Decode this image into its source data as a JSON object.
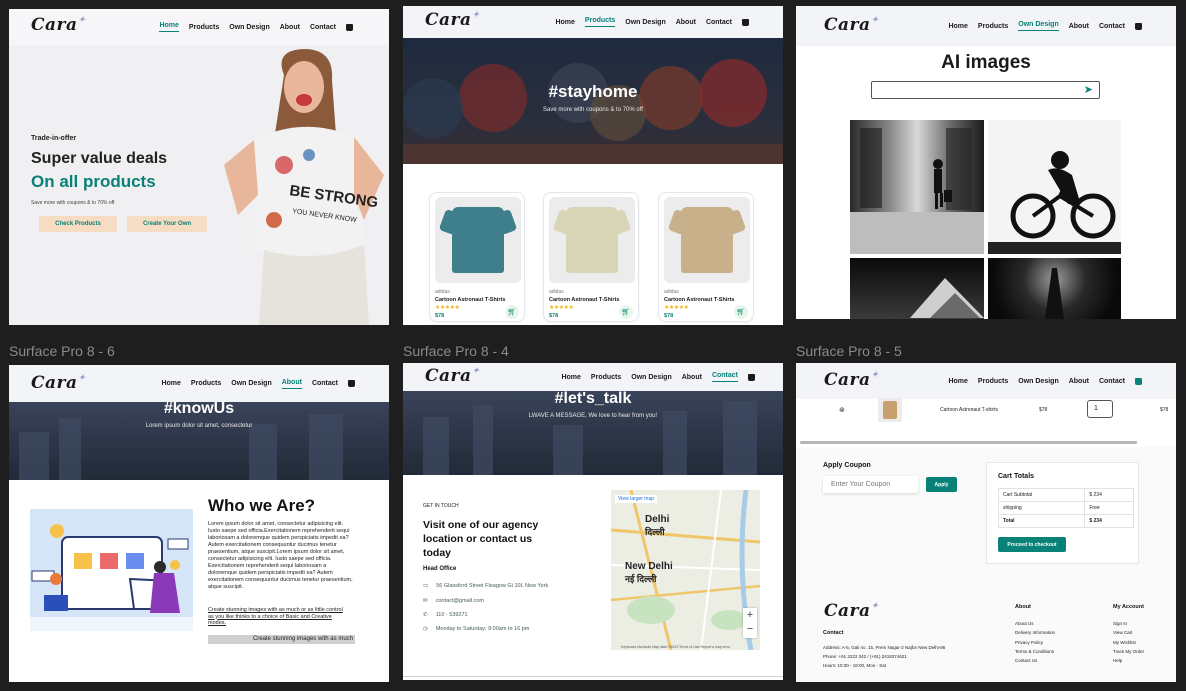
{
  "labels": {
    "f6": "Surface Pro 8 - 6",
    "f4": "Surface Pro 8 - 4",
    "f5": "Surface Pro 8 - 5"
  },
  "nav": {
    "logo": "Cara",
    "home": "Home",
    "products": "Products",
    "own_design": "Own Design",
    "about": "About",
    "contact": "Contact"
  },
  "home": {
    "kicker": "Trade-in-offer",
    "headline": "Super value deals",
    "headline2": "On all products",
    "sub": "Save more with coupons & to 70% off",
    "btn1": "Check Products",
    "btn2": "Create Your Own",
    "shirt_text1": "BE STRONG",
    "shirt_text2": "YOU NEVER KNOW"
  },
  "products": {
    "banner_title": "#stayhome",
    "banner_sub": "Save more with coupons & to 70% off",
    "items": [
      {
        "brand": "adidas",
        "name": "Cartoon Astronaut T-Shirts",
        "stars": "★★★★★",
        "price": "$78",
        "color": "#3f7f8c"
      },
      {
        "brand": "adidas",
        "name": "Cartoon Astronaut T-Shirts",
        "stars": "★★★★★",
        "price": "$78",
        "color": "#d9d6b8"
      },
      {
        "brand": "adidas",
        "name": "Cartoon Astronaut T-Shirts",
        "stars": "★★★★★",
        "price": "$78",
        "color": "#c8b08a"
      }
    ]
  },
  "design": {
    "title": "AI images"
  },
  "about": {
    "banner_title": "#knowUs",
    "banner_sub": "Lorem ipsum dolor sit amet, consectetur",
    "heading": "Who we Are?",
    "body": "Lorem ipsum dolor sit amet, consectetur adipisicing elit. Iusto saepe sed officia.Exercitationem reprehenderit sequi laboriosam a doloremque quidem perspiciatis impedit ea? Autem exercitationem consequuntur ducimus tenetur praesentium, atque suscipit.Lorem ipsum dolor sit amet, consectetur adipisicing elit. Iusto saepe sed officia. Exercitationem reprehenderit sequi laboriosam a doloremque quidem perspiciatis impedit ea? Autem exercitationem consequuntur ducimus tenetur praesentium, atque suscipit.",
    "link": "Create stunning images with as much or as little control as you like thinks to a choice of Basic and Creative modes.",
    "marquee": "Create stunning images with as much"
  },
  "contact": {
    "banner_title": "#let's_talk",
    "banner_sub": "LWAVE A MESSAGE, We love to hear from you!",
    "get_in_touch": "GET IN TOUCH",
    "heading": "Visit one of our agency location or contact us today",
    "head_office": "Head Office",
    "address": "56 Glassford Street Fleagow Gi 10L New York",
    "email": "contact@gmail.com",
    "phone": "110 - 539271",
    "hours": "Monday to Saturday: 9:00am to 16 pm",
    "map_link": "View larger map",
    "map_city1": "Delhi",
    "map_city1_hi": "दिल्ली",
    "map_city2": "New Delhi",
    "map_city2_hi": "नई दिल्ली",
    "map_footer": "Keyboard shortcuts   Map data ©2023   Terms of Use   Report a map error"
  },
  "cart": {
    "row_name": "Cartoon Astronaut T-shirts",
    "row_price": "$78",
    "row_qty": "1",
    "row_subtotal": "$78",
    "coupon_title": "Apply Coupon",
    "coupon_placeholder": "Enter Your Coupon",
    "apply": "Apply",
    "totals_title": "Cart Totals",
    "totals": [
      {
        "k": "Cart Subtotal",
        "v": "$ 234"
      },
      {
        "k": "shipping",
        "v": "Free"
      },
      {
        "k": "Total",
        "v": "$ 234"
      }
    ],
    "checkout": "Proceed to checkout",
    "footer_logo": "Cara",
    "contact_h": "Contact",
    "address": "Address: A-5, Gali no. 15, Prem Nagar-2 Najfor New Delhi-86",
    "phone": "Phone: +91 2222 342 / (+91) 2418374621",
    "hours": "Hours: 10:30 - 18:00, Mon - Sat",
    "about_h": "About",
    "about_links": [
      "About Us",
      "Delivery Information",
      "Privacy Policy",
      "Terms & Conditions",
      "Contact Us"
    ],
    "account_h": "My Account",
    "account_links": [
      "Sign In",
      "View Cart",
      "My Wishlist",
      "Track My Order",
      "Help"
    ]
  },
  "colors": {
    "accent": "#088178",
    "banner": "#2b3345",
    "nav_bg": "#f3f4f8",
    "page_bg": "#1e1e1e"
  }
}
